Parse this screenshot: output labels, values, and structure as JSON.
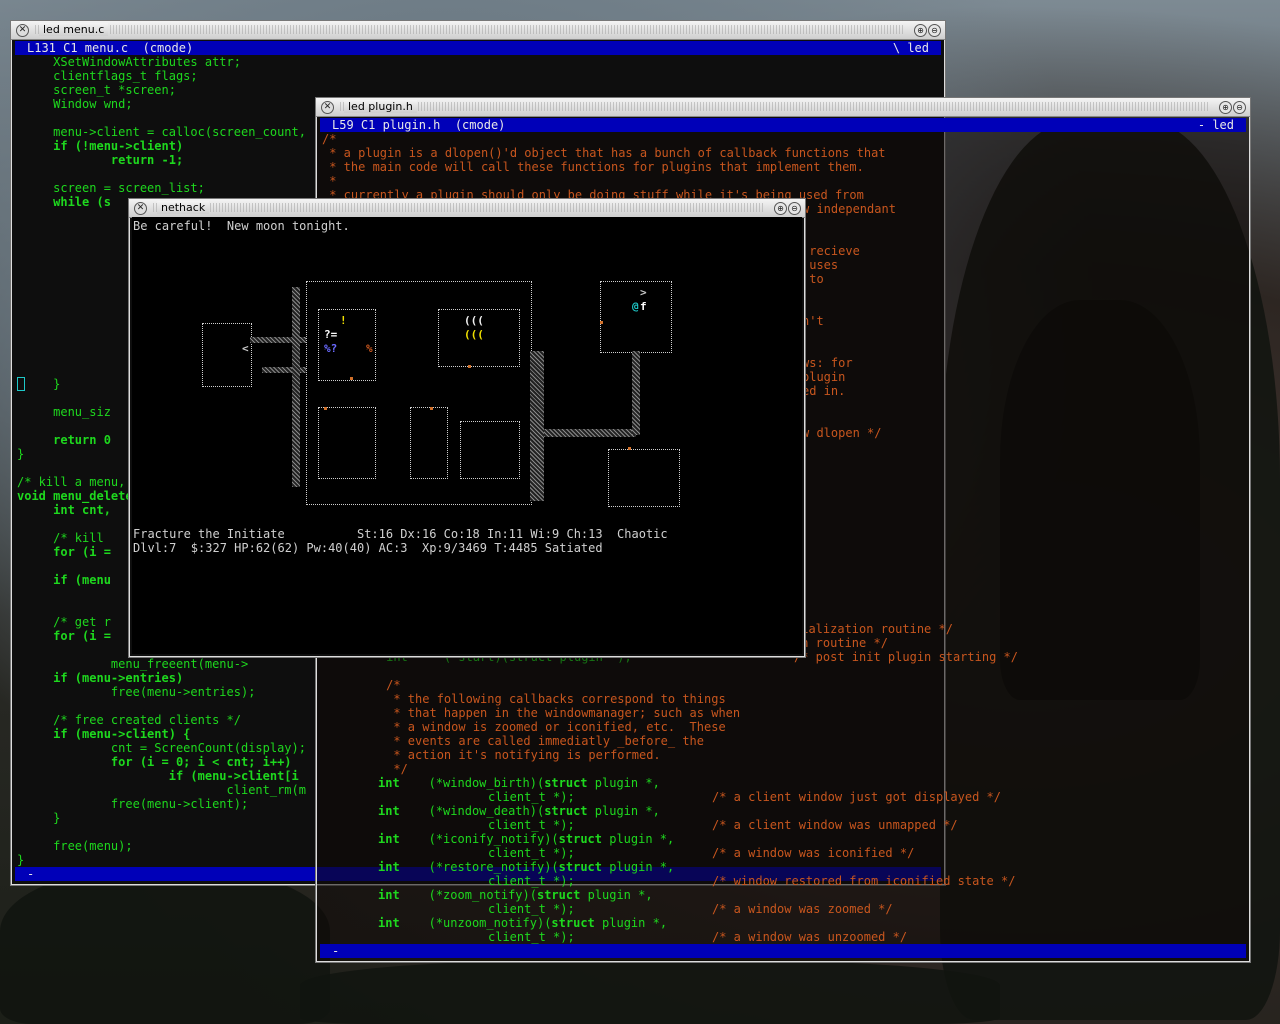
{
  "windows": {
    "menu_c": {
      "title": "led menu.c",
      "status_left": "L131 C1 menu.c  (cmode)",
      "status_right": "\\ led",
      "status_bottom": "-",
      "code": [
        "     XSetWindowAttributes attr;",
        "     clientflags_t flags;",
        "     screen_t *screen;",
        "     Window wnd;",
        "",
        "     menu->client = calloc(screen_count,",
        "     if (!menu->client)",
        "             return -1;",
        "",
        "     screen = screen_list;",
        "     while (s"
      ],
      "code_lower": [
        "     }",
        "",
        "     menu_siz",
        "",
        "     return 0",
        "}",
        "",
        "/* kill a menu,",
        "void menu_delete",
        "     int cnt,",
        "",
        "     /* kill",
        "     for (i =",
        "",
        "     if (menu",
        "",
        "",
        "     /* get r",
        "     for (i =",
        "",
        "             menu_freeent(menu->",
        "     if (menu->entries)",
        "             free(menu->entries);",
        "",
        "     /* free created clients */",
        "     if (menu->client) {",
        "             cnt = ScreenCount(display);",
        "             for (i = 0; i < cnt; i++)",
        "                     if (menu->client[i",
        "                             client_rm(m",
        "             free(menu->client);",
        "     }",
        "",
        "     free(menu);",
        "}"
      ]
    },
    "plugin_h": {
      "title": "led plugin.h",
      "status_left": "L59 C1 plugin.h  (cmode)",
      "status_right": "- led",
      "status_bottom": "-",
      "code_top": [
        "/*",
        " * a plugin is a dlopen()'d object that has a bunch of callback functions that",
        " * the main code will call these functions for plugins that implement them.",
        " *",
        " * currently a plugin should only be doing stuff while it's being used from"
      ],
      "right_fragments": [
        "w independant",
        "",
        "",
        " recieve",
        " uses",
        " to",
        "",
        "",
        "n't",
        "",
        "",
        "ws: for",
        "plugin",
        "ed in.",
        "",
        "",
        "w dlopen */"
      ],
      "mid_fragments": [
        "tialization routine */",
        "th routine */",
        "/* post init plugin starting */"
      ],
      "mid_left": "     int     (*start)(struct plugin *);",
      "comment_block": [
        "     /*",
        "      * the following callbacks correspond to things",
        "      * that happen in the windowmanager; such as when",
        "      * a window is zoomed or iconified, etc.  These",
        "      * events are called immediatly _before_ the",
        "      * action it's notifying is performed.",
        "      */"
      ],
      "callbacks": [
        {
          "decl": "(*window_birth)(",
          "type": "plugin *,",
          "comment": "/* a client window just got displayed */"
        },
        {
          "decl": "(*window_death)(",
          "type": "plugin *,",
          "comment": "/* a client window was unmapped */"
        },
        {
          "decl": "(*iconify_notify)(",
          "type": "plugin *,",
          "comment": "/* a window was iconified */"
        },
        {
          "decl": "(*restore_notify)(",
          "type": "plugin *,",
          "comment": "/* window restored from iconified state */"
        },
        {
          "decl": "(*zoom_notify)(",
          "type": "plugin *,",
          "comment": "/* a window was zoomed */"
        },
        {
          "decl": "(*unzoom_notify)(",
          "type": "plugin *,",
          "comment": "/* a window was unzoomed */"
        }
      ],
      "kw_int": "int",
      "kw_struct": "struct",
      "client_arg": "client_t *);"
    },
    "nethack": {
      "title": "nethack",
      "message": "Be careful!  New moon tonight.",
      "status_line1": "Fracture the Initiate          St:16 Dx:16 Co:18 In:11 Wi:9 Ch:13  Chaotic",
      "status_line2": "Dlvl:7  $:327 HP:62(62) Pw:40(40) AC:3  Xp:9/3469 T:4485 Satiated"
    }
  },
  "colors": {
    "code_green": "#1ed81e",
    "comment_orange": "#c8561e",
    "status_blue": "#0000b8"
  }
}
